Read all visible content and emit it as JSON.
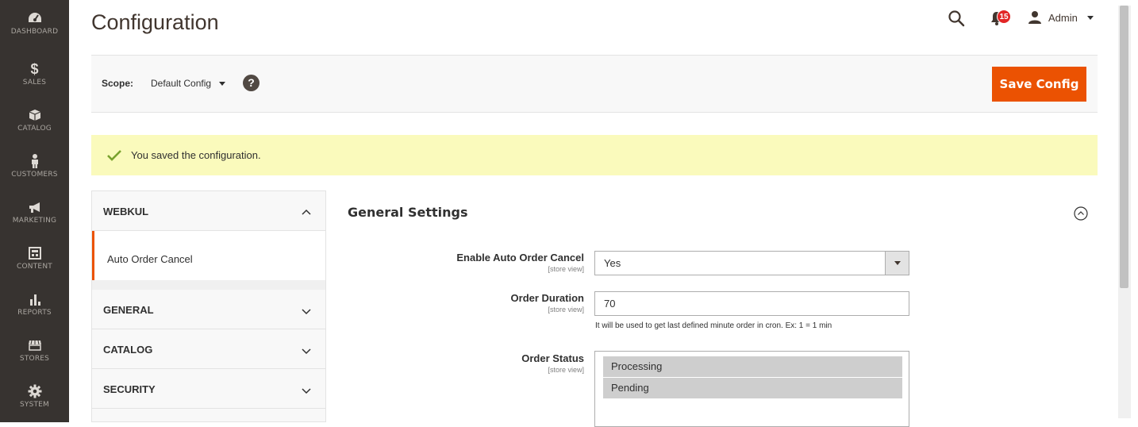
{
  "nav": [
    {
      "label": "DASHBOARD",
      "icon": "dashboard-icon"
    },
    {
      "label": "SALES",
      "icon": "dollar-icon"
    },
    {
      "label": "CATALOG",
      "icon": "box-icon"
    },
    {
      "label": "CUSTOMERS",
      "icon": "person-icon"
    },
    {
      "label": "MARKETING",
      "icon": "megaphone-icon"
    },
    {
      "label": "CONTENT",
      "icon": "layout-icon"
    },
    {
      "label": "REPORTS",
      "icon": "bar-chart-icon"
    },
    {
      "label": "STORES",
      "icon": "store-icon"
    },
    {
      "label": "SYSTEM",
      "icon": "gear-icon"
    }
  ],
  "header": {
    "title": "Configuration",
    "notifications_count": "15",
    "user_label": "Admin"
  },
  "scope": {
    "label": "Scope:",
    "value": "Default Config",
    "help": "?",
    "save_label": "Save Config"
  },
  "message": {
    "text": "You saved the configuration."
  },
  "tabs": [
    {
      "label": "WEBKUL",
      "expanded": true,
      "items": [
        "Auto Order Cancel"
      ]
    },
    {
      "label": "GENERAL",
      "expanded": false
    },
    {
      "label": "CATALOG",
      "expanded": false
    },
    {
      "label": "SECURITY",
      "expanded": false
    }
  ],
  "section": {
    "title": "General Settings",
    "fields": {
      "enable": {
        "label": "Enable Auto Order Cancel",
        "scope": "[store view]",
        "value": "Yes"
      },
      "duration": {
        "label": "Order Duration",
        "scope": "[store view]",
        "value": "70",
        "note": "It will be used to get last defined minute order in cron. Ex: 1 = 1 min"
      },
      "status": {
        "label": "Order Status",
        "scope": "[store view]",
        "options": [
          "Processing",
          "Pending"
        ]
      }
    }
  },
  "colors": {
    "nav_bg": "#373330",
    "accent": "#eb5202",
    "message_bg": "#fafabc",
    "badge": "#e22626"
  }
}
